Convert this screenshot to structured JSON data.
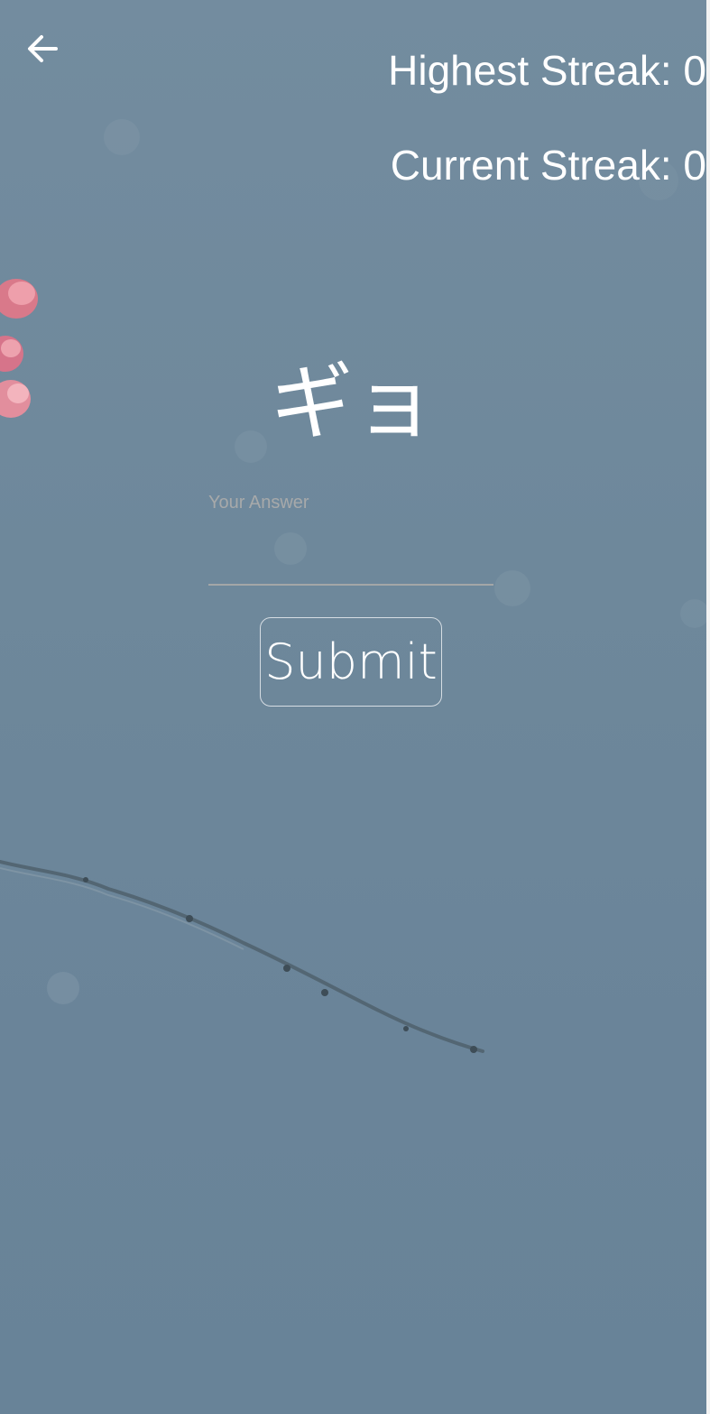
{
  "header": {
    "back_icon": "arrow-left-icon",
    "highest_streak_text": "Highest Streak: 0",
    "current_streak_text": "Current Streak: 0"
  },
  "quiz": {
    "character": "ギョ",
    "answer_label": "Your Answer",
    "answer_value": "",
    "submit_label": "Submit"
  },
  "background": {
    "image": "cherry-blossom-branch-against-sky",
    "sky_color": "#6f899c",
    "blossom_color": "#e8919c",
    "branch_color": "#4c5d69"
  }
}
